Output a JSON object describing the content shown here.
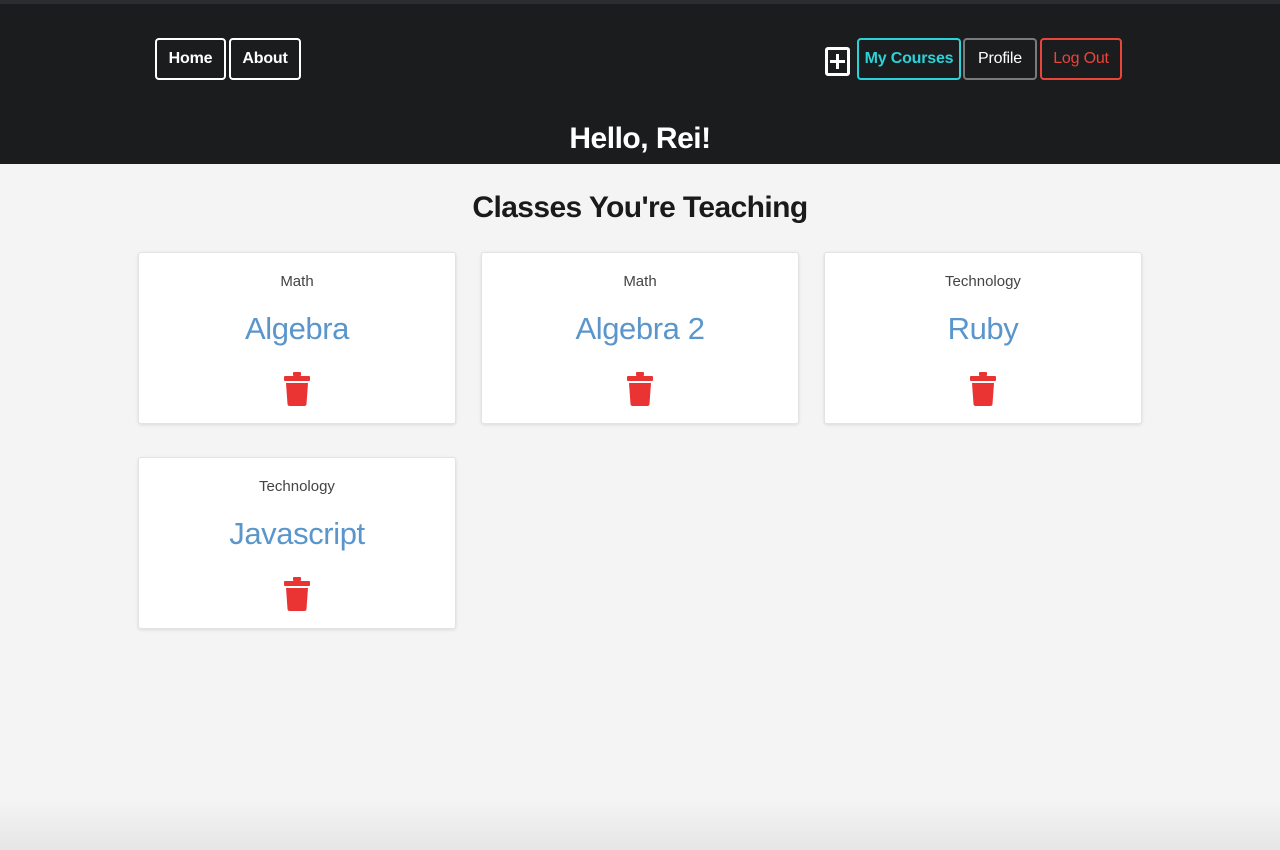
{
  "nav": {
    "home_label": "Home",
    "about_label": "About",
    "add_icon": "plus-square-icon",
    "my_courses_label": "My Courses",
    "profile_label": "Profile",
    "logout_label": "Log Out"
  },
  "greeting": "Hello, Rei!",
  "section_title": "Classes You're Teaching",
  "courses": [
    {
      "subject": "Math",
      "name": "Algebra",
      "action_icon": "trash-icon"
    },
    {
      "subject": "Math",
      "name": "Algebra 2",
      "action_icon": "trash-icon"
    },
    {
      "subject": "Technology",
      "name": "Ruby",
      "action_icon": "trash-icon"
    },
    {
      "subject": "Technology",
      "name": "Javascript",
      "action_icon": "trash-icon"
    }
  ],
  "colors": {
    "header_bg": "#1b1c1e",
    "page_bg": "#f4f4f4",
    "accent_teal": "#2ad3d9",
    "danger_red": "#e9453a",
    "course_link": "#5a96cc",
    "trash_red": "#ea3434"
  }
}
